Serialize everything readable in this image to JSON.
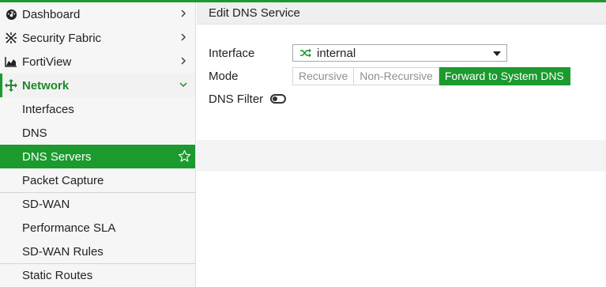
{
  "colors": {
    "accent": "#1b9a2d",
    "sidebar_bg": "#f6f6f6",
    "header_bg": "#efefef"
  },
  "sidebar": {
    "items": [
      {
        "label": "Dashboard",
        "icon": "dashboard-icon",
        "chevron": "right"
      },
      {
        "label": "Security Fabric",
        "icon": "security-fabric-icon",
        "chevron": "right"
      },
      {
        "label": "FortiView",
        "icon": "fortiview-icon",
        "chevron": "right"
      },
      {
        "label": "Network",
        "icon": "network-icon",
        "chevron": "down"
      },
      {
        "label": "Interfaces"
      },
      {
        "label": "DNS"
      },
      {
        "label": "DNS Servers",
        "active": true,
        "icon": "star-icon"
      },
      {
        "label": "Packet Capture"
      },
      {
        "label": "SD-WAN"
      },
      {
        "label": "Performance SLA"
      },
      {
        "label": "SD-WAN Rules"
      },
      {
        "label": "Static Routes"
      }
    ]
  },
  "main": {
    "title": "Edit DNS Service",
    "form": {
      "interface": {
        "label": "Interface",
        "value": "internal",
        "icon": "interface-shuffle-icon"
      },
      "mode": {
        "label": "Mode",
        "options": [
          "Recursive",
          "Non-Recursive",
          "Forward to System DNS"
        ],
        "selected": "Forward to System DNS"
      },
      "dns_filter": {
        "label": "DNS Filter",
        "enabled": false
      }
    }
  }
}
